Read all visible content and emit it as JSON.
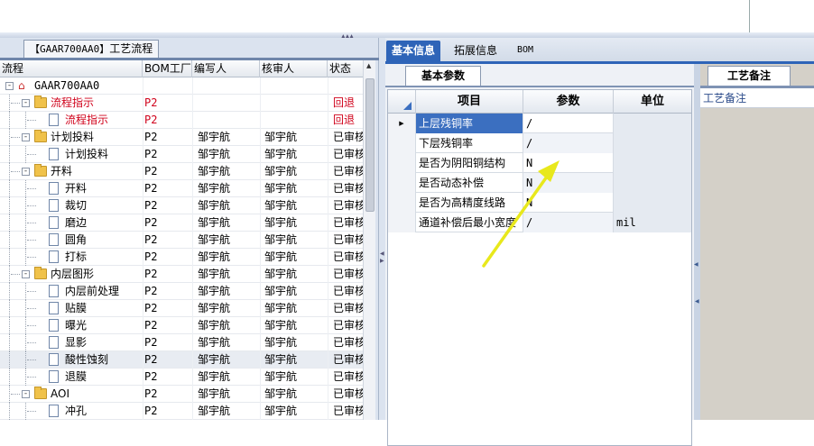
{
  "left_panel": {
    "tab_label_code": "【GAAR700AA0】",
    "tab_label_text": "工艺流程",
    "columns": [
      "流程",
      "BOM工厂",
      "编写人",
      "核审人",
      "状态"
    ],
    "rows": [
      {
        "level": 0,
        "icon": "home",
        "expander": "-",
        "name": "GAAR700AA0",
        "bom": "",
        "writer": "",
        "reviewer": "",
        "status": "",
        "red": false
      },
      {
        "level": 1,
        "icon": "folder",
        "expander": "-",
        "name": "流程指示",
        "bom": "P2",
        "writer": "",
        "reviewer": "",
        "status": "回退",
        "red": true
      },
      {
        "level": 2,
        "icon": "doc",
        "expander": "",
        "name": "流程指示",
        "bom": "P2",
        "writer": "",
        "reviewer": "",
        "status": "回退",
        "red": true
      },
      {
        "level": 1,
        "icon": "folder",
        "expander": "-",
        "name": "计划投料",
        "bom": "P2",
        "writer": "邹宇航",
        "reviewer": "邹宇航",
        "status": "已审核",
        "red": false
      },
      {
        "level": 2,
        "icon": "doc",
        "expander": "",
        "name": "计划投料",
        "bom": "P2",
        "writer": "邹宇航",
        "reviewer": "邹宇航",
        "status": "已审核",
        "red": false
      },
      {
        "level": 1,
        "icon": "folder",
        "expander": "-",
        "name": "开料",
        "bom": "P2",
        "writer": "邹宇航",
        "reviewer": "邹宇航",
        "status": "已审核",
        "red": false
      },
      {
        "level": 2,
        "icon": "doc",
        "expander": "",
        "name": "开料",
        "bom": "P2",
        "writer": "邹宇航",
        "reviewer": "邹宇航",
        "status": "已审核",
        "red": false
      },
      {
        "level": 2,
        "icon": "doc",
        "expander": "",
        "name": "裁切",
        "bom": "P2",
        "writer": "邹宇航",
        "reviewer": "邹宇航",
        "status": "已审核",
        "red": false
      },
      {
        "level": 2,
        "icon": "doc",
        "expander": "",
        "name": "磨边",
        "bom": "P2",
        "writer": "邹宇航",
        "reviewer": "邹宇航",
        "status": "已审核",
        "red": false
      },
      {
        "level": 2,
        "icon": "doc",
        "expander": "",
        "name": "圆角",
        "bom": "P2",
        "writer": "邹宇航",
        "reviewer": "邹宇航",
        "status": "已审核",
        "red": false
      },
      {
        "level": 2,
        "icon": "doc",
        "expander": "",
        "name": "打标",
        "bom": "P2",
        "writer": "邹宇航",
        "reviewer": "邹宇航",
        "status": "已审核",
        "red": false
      },
      {
        "level": 1,
        "icon": "folder",
        "expander": "-",
        "name": "内层图形",
        "bom": "P2",
        "writer": "邹宇航",
        "reviewer": "邹宇航",
        "status": "已审核",
        "red": false
      },
      {
        "level": 2,
        "icon": "doc",
        "expander": "",
        "name": "内层前处理",
        "bom": "P2",
        "writer": "邹宇航",
        "reviewer": "邹宇航",
        "status": "已审核",
        "red": false
      },
      {
        "level": 2,
        "icon": "doc",
        "expander": "",
        "name": "贴膜",
        "bom": "P2",
        "writer": "邹宇航",
        "reviewer": "邹宇航",
        "status": "已审核",
        "red": false
      },
      {
        "level": 2,
        "icon": "doc",
        "expander": "",
        "name": "曝光",
        "bom": "P2",
        "writer": "邹宇航",
        "reviewer": "邹宇航",
        "status": "已审核",
        "red": false
      },
      {
        "level": 2,
        "icon": "doc",
        "expander": "",
        "name": "显影",
        "bom": "P2",
        "writer": "邹宇航",
        "reviewer": "邹宇航",
        "status": "已审核",
        "red": false
      },
      {
        "level": 2,
        "icon": "doc",
        "expander": "",
        "name": "酸性蚀刻",
        "bom": "P2",
        "writer": "邹宇航",
        "reviewer": "邹宇航",
        "status": "已审核",
        "red": false,
        "selected": true
      },
      {
        "level": 2,
        "icon": "doc",
        "expander": "",
        "name": "退膜",
        "bom": "P2",
        "writer": "邹宇航",
        "reviewer": "邹宇航",
        "status": "已审核",
        "red": false
      },
      {
        "level": 1,
        "icon": "folder",
        "expander": "-",
        "name": "AOI",
        "bom": "P2",
        "writer": "邹宇航",
        "reviewer": "邹宇航",
        "status": "已审核",
        "red": false
      },
      {
        "level": 2,
        "icon": "doc",
        "expander": "",
        "name": "冲孔",
        "bom": "P2",
        "writer": "邹宇航",
        "reviewer": "邹宇航",
        "status": "已审核",
        "red": false
      }
    ]
  },
  "right_panel": {
    "tabs": [
      "基本信息",
      "拓展信息",
      "BOM"
    ],
    "params_tab": "基本参数",
    "params_columns": [
      "项目",
      "参数",
      "单位"
    ],
    "params_rows": [
      {
        "item": "上层残铜率",
        "value": "/",
        "unit": ""
      },
      {
        "item": "下层残铜率",
        "value": "/",
        "unit": ""
      },
      {
        "item": "是否为阴阳铜结构",
        "value": "N",
        "unit": ""
      },
      {
        "item": "是否动态补偿",
        "value": "N",
        "unit": ""
      },
      {
        "item": "是否为高精度线路",
        "value": "N",
        "unit": ""
      },
      {
        "item": "通道补偿后最小宽度",
        "value": "/",
        "unit": "mil"
      }
    ],
    "notes_tab": "工艺备注",
    "notes_header": "工艺备注"
  },
  "colors": {
    "accent": "#2e64b8",
    "status_red": "#d0021b",
    "arrow": "#e8e81c"
  }
}
